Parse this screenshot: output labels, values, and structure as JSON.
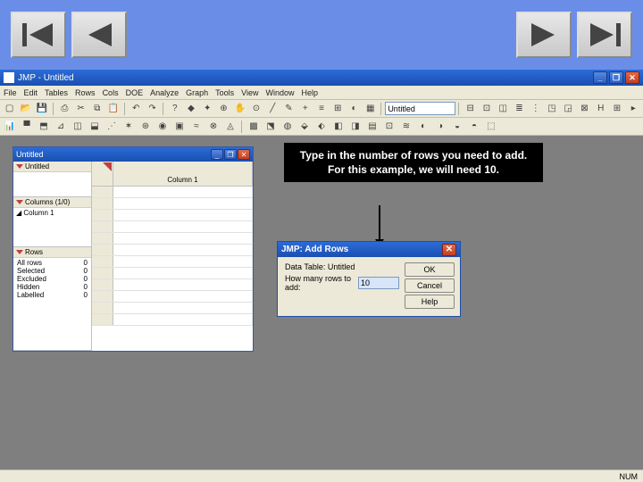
{
  "nav": {
    "first_icon": "skip-back",
    "prev_icon": "play-back",
    "next_icon": "play-forward",
    "last_icon": "skip-forward"
  },
  "app": {
    "title": "JMP - Untitled",
    "menus": [
      "File",
      "Edit",
      "Tables",
      "Rows",
      "Cols",
      "DOE",
      "Analyze",
      "Graph",
      "Tools",
      "View",
      "Window",
      "Help"
    ],
    "combo_value": "Untitled"
  },
  "data_window": {
    "title": "Untitled",
    "panel1_label": "Untitled",
    "columns_header": "Columns (1/0)",
    "column1_name": "Column 1",
    "rows_header": "Rows",
    "rows_stats": [
      {
        "label": "All rows",
        "value": "0"
      },
      {
        "label": "Selected",
        "value": "0"
      },
      {
        "label": "Excluded",
        "value": "0"
      },
      {
        "label": "Hidden",
        "value": "0"
      },
      {
        "label": "Labelled",
        "value": "0"
      }
    ],
    "grid_col1": "Column 1"
  },
  "callout": {
    "text": "Type in the number of rows you need to add. For this example, we will need 10."
  },
  "dialog": {
    "title": "JMP: Add Rows",
    "data_table_label": "Data Table:",
    "data_table_value": "Untitled",
    "how_many_label": "How many rows to add:",
    "how_many_value": "10",
    "ok": "OK",
    "cancel": "Cancel",
    "help": "Help"
  },
  "status": {
    "right": "NUM"
  }
}
